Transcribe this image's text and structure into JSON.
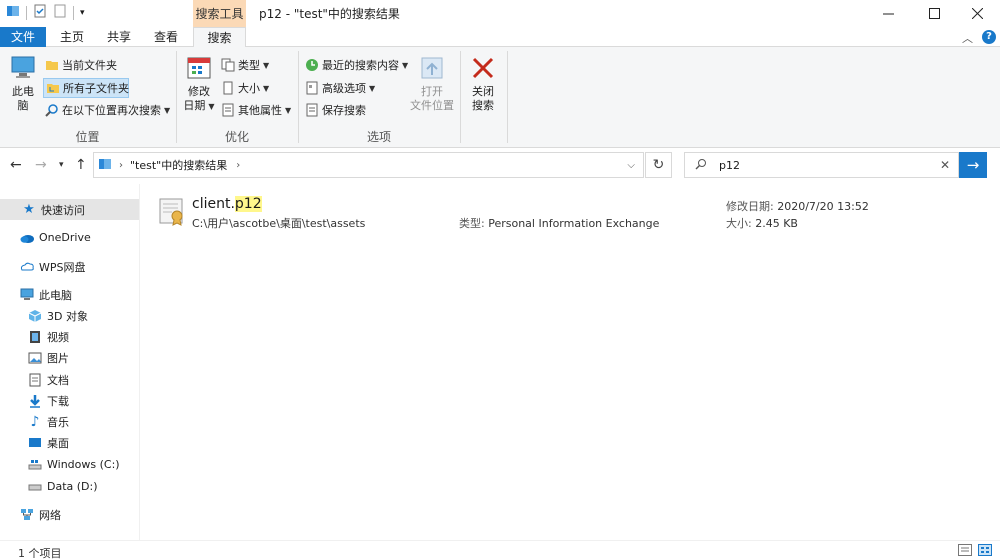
{
  "window": {
    "contextual_tab": "搜索工具",
    "title": "p12 - \"test\"中的搜索结果"
  },
  "tabs": {
    "file": "文件",
    "home": "主页",
    "share": "共享",
    "view": "查看",
    "search": "搜索"
  },
  "ribbon": {
    "this_pc_1": "此电",
    "this_pc_2": "脑",
    "current_folder": "当前文件夹",
    "all_subfolders": "所有子文件夹",
    "search_again": "在以下位置再次搜索",
    "group_location": "位置",
    "modified_1": "修改",
    "modified_2": "日期",
    "kind": "类型",
    "size": "大小",
    "other_props": "其他属性",
    "group_optimize": "优化",
    "recent_searches": "最近的搜索内容",
    "advanced_options": "高级选项",
    "save_search": "保存搜索",
    "group_options": "选项",
    "open_loc_1": "打开",
    "open_loc_2": "文件位置",
    "close_1": "关闭",
    "close_2": "搜索"
  },
  "address": {
    "path": "\"test\"中的搜索结果"
  },
  "search": {
    "query": "p12"
  },
  "nav": {
    "quick_access": "快速访问",
    "onedrive": "OneDrive",
    "wps": "WPS网盘",
    "this_pc": "此电脑",
    "objects3d": "3D 对象",
    "videos": "视频",
    "pictures": "图片",
    "documents": "文档",
    "downloads": "下载",
    "music": "音乐",
    "desktop": "桌面",
    "drive_c": "Windows (C:)",
    "drive_d": "Data (D:)",
    "network": "网络"
  },
  "result": {
    "name_prefix": "client.",
    "name_highlight": "p12",
    "path": "C:\\用户\\ascotbe\\桌面\\test\\assets",
    "type_label": "类型:",
    "type_value": "Personal Information Exchange",
    "modified_label": "修改日期:",
    "modified_value": "2020/7/20 13:52",
    "size_label": "大小:",
    "size_value": "2.45 KB"
  },
  "status": {
    "count": "1 个项目"
  },
  "colors": {
    "accent": "#1979ca",
    "contextual": "#fbd9b6",
    "highlight": "#fff78c"
  }
}
